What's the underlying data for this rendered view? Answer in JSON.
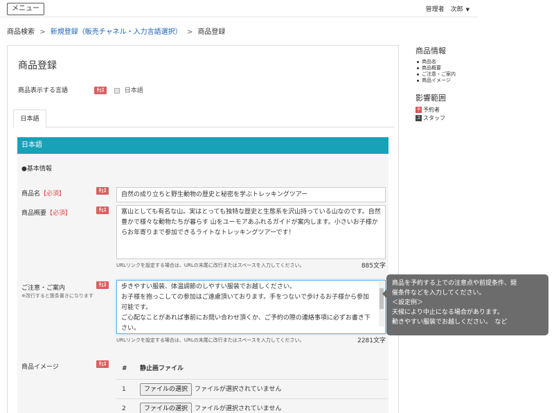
{
  "topbar": {
    "menu_label": "メニュー",
    "user_name": "管理者　次郎"
  },
  "breadcrumb": {
    "item1": "商品検索",
    "item2": "新規登録（販売チャネル・入力言語選択）",
    "item3": "商品登録",
    "separator": ">"
  },
  "panel": {
    "title": "商品登録",
    "lang_label": "商品表示する言語",
    "lang_option": "日本語",
    "tab_label": "日本語",
    "section_title": "日本語",
    "subhead": "●基本情報"
  },
  "badge_label": "ﾁｪｽ",
  "fields": {
    "name": {
      "label": "商品名",
      "required": "【必須】",
      "value": "自然の成り立ちと野生動物の歴史と秘密を学ぶトレッキングツアー"
    },
    "summary": {
      "label": "商品概要",
      "required": "【必須】",
      "value": "富山としても有名な山。実はとっても独特な歴史と生態系を沢山持っている山なのです。自然豊かで様々な動物たちが暮らす 山をユーモアあふれるガイドが案内します。小さいお子様からお年寄りまで参加できるライトなトレッキングツアーです！",
      "hint": "URLリンクを設定する場合は、URLの末尾に改行またはスペースを入力してください。",
      "count": "885文字"
    },
    "notes": {
      "label": "ご注意・ご案内",
      "sublabel": "※改行すると箇条書きになります",
      "line1": "歩きやすい服装、体温調節のしやすい服装でお越しください。",
      "line2": "お子様を抱っこしての参加はご遠慮頂いております。手をつないで歩けるお子様から参加可能です。",
      "line3": "ご心配なことがあれば事前にお問い合わせ頂くか、ご予約の際の連絡事項に必ずお書き下さい。",
      "hint": "URLリンクを設定する場合は、URLの末尾に改行またはスペースを入力してください。",
      "count": "2281文字"
    },
    "images": {
      "label": "商品イメージ",
      "col_num": "#",
      "col_file": "静止画ファイル",
      "rows": [
        {
          "num": "1",
          "button": "ファイルの選択",
          "status": "ファイルが選択されていません"
        },
        {
          "num": "2",
          "button": "ファイルの選択",
          "status": "ファイルが選択されていません"
        }
      ]
    }
  },
  "sidebar": {
    "info_title": "商品情報",
    "info_items": [
      "商品名",
      "商品概要",
      "ご注意・ご案内",
      "商品イメージ"
    ],
    "scope_title": "影響範囲",
    "scope_items": [
      {
        "badge": "予",
        "label": "予約者",
        "color": "#d9534f"
      },
      {
        "badge": "ス",
        "label": "スタッフ",
        "color": "#444444"
      }
    ]
  },
  "tooltip": {
    "line1": "商品を予約する上での注意点や前提条件、開",
    "line2": "催条件などを入力してください。",
    "line3": "＜設定例＞",
    "line4": "天候により中止になる場合があります。",
    "line5": "動きやすい服装でお越しください。　など"
  }
}
